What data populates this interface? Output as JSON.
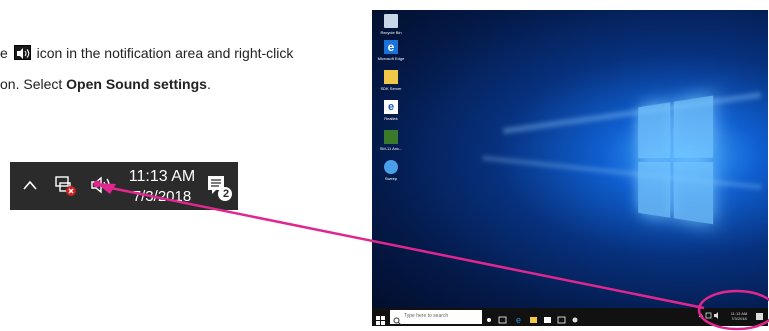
{
  "instruction": {
    "line1_prefix": "e",
    "line1_suffix": "icon in the notification area and right-click",
    "line2_prefix": "on. Select ",
    "line2_bold": "Open Sound settings",
    "line2_suffix": "."
  },
  "tray_zoom": {
    "time": "11:13 AM",
    "date": "7/3/2018",
    "notification_count": "2",
    "icons": [
      "chevron-up-icon",
      "network-disconnected-icon",
      "speaker-icon",
      "action-center-icon"
    ]
  },
  "desktop": {
    "icons": [
      {
        "label": "Recycle Bin"
      },
      {
        "label": "Microsoft Edge"
      },
      {
        "label": "SDK Server"
      },
      {
        "label": "Realtek"
      },
      {
        "label": "SM-11 Anc..."
      },
      {
        "label": "Sweep"
      }
    ],
    "taskbar": {
      "search_placeholder": "Type here to search",
      "time": "11:13 AM",
      "date": "7/3/2018"
    }
  },
  "colors": {
    "callout": "#e0278f",
    "tray_bg": "#2b2b2b",
    "desktop_blue": "#0f5fd0"
  }
}
